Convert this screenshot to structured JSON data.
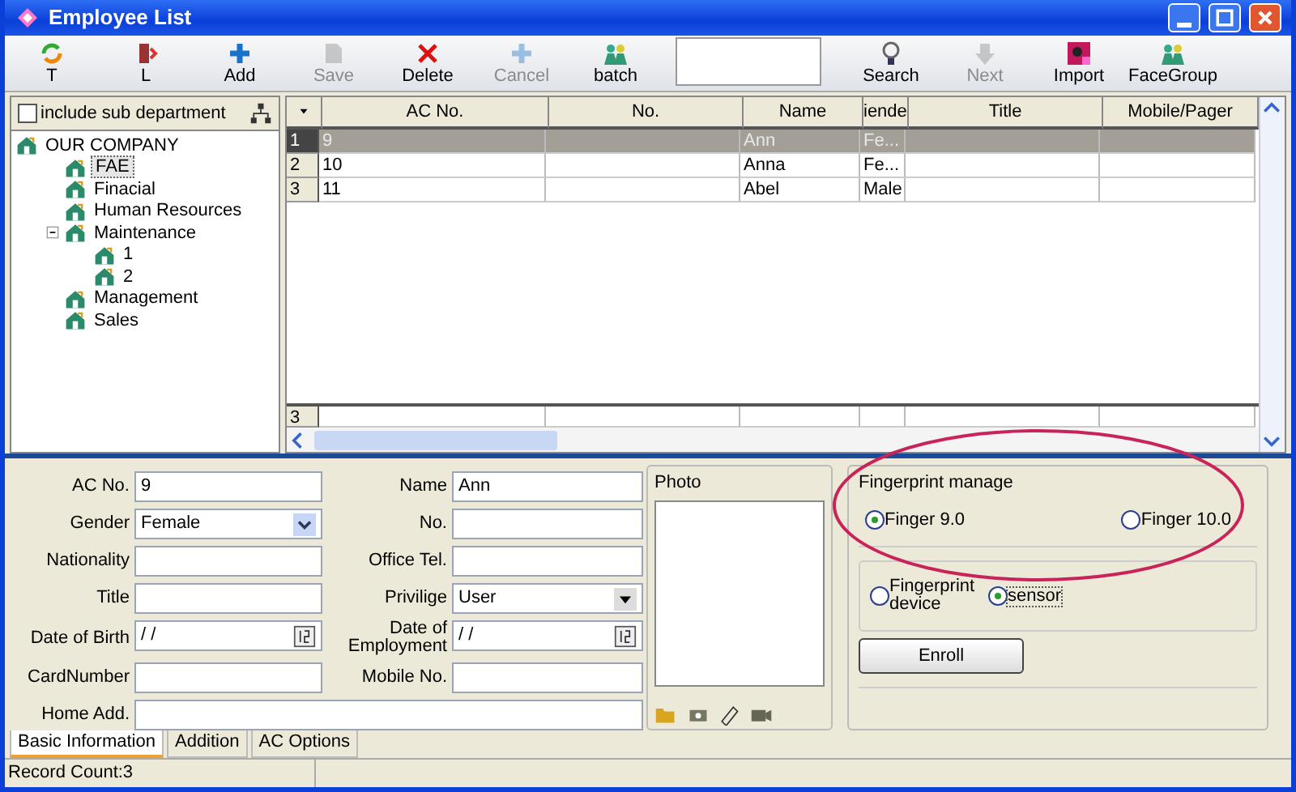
{
  "window": {
    "title": "Employee List"
  },
  "toolbar": [
    {
      "label": "T",
      "disabled": false
    },
    {
      "label": "L",
      "disabled": false
    },
    {
      "label": "Add",
      "disabled": false
    },
    {
      "label": "Save",
      "disabled": true
    },
    {
      "label": "Delete",
      "disabled": false
    },
    {
      "label": "Cancel",
      "disabled": true
    },
    {
      "label": "batch",
      "disabled": false
    },
    {
      "label": "Search",
      "disabled": false
    },
    {
      "label": "Next",
      "disabled": true
    },
    {
      "label": "Import",
      "disabled": false
    },
    {
      "label": "FaceGroup",
      "disabled": false
    }
  ],
  "department_panel": {
    "include_sub_department": {
      "label": "include sub department",
      "checked": false
    },
    "tree": [
      {
        "label": "OUR COMPANY",
        "selected": false,
        "children": [
          {
            "label": "FAE",
            "selected": true
          },
          {
            "label": "Finacial",
            "selected": false
          },
          {
            "label": "Human Resources",
            "selected": false
          },
          {
            "label": "Maintenance",
            "selected": false,
            "expanded": true,
            "children": [
              {
                "label": "1",
                "selected": false
              },
              {
                "label": "2",
                "selected": false
              }
            ]
          },
          {
            "label": "Management",
            "selected": false
          },
          {
            "label": "Sales",
            "selected": false
          }
        ]
      }
    ]
  },
  "grid": {
    "columns": [
      "AC No.",
      "No.",
      "Name",
      "iende",
      "Title",
      "Mobile/Pager"
    ],
    "rows": [
      {
        "row_header": "1",
        "selected": true,
        "ac_no": "9",
        "name": "Ann",
        "column_4": "Fe..."
      },
      {
        "row_header": "2",
        "selected": false,
        "ac_no": "10",
        "name": "Anna",
        "column_4": "Fe..."
      },
      {
        "row_header": "3",
        "selected": false,
        "ac_no": "11",
        "name": "Abel",
        "column_4": "Male"
      }
    ],
    "footer_row": "3"
  },
  "form": {
    "left": [
      {
        "label": "AC No.",
        "kind": "text",
        "value": "9"
      },
      {
        "label": "Gender",
        "kind": "combo",
        "value": "Female"
      },
      {
        "label": "Nationality",
        "kind": "text"
      },
      {
        "label": "Title",
        "kind": "text"
      },
      {
        "label": "Date of Birth",
        "kind": "date",
        "value": "/ /"
      },
      {
        "label": "CardNumber",
        "kind": "text"
      }
    ],
    "right": [
      {
        "label": "Name",
        "kind": "text",
        "value": "Ann"
      },
      {
        "label": "No.",
        "kind": "text"
      },
      {
        "label": "Office Tel.",
        "kind": "text"
      },
      {
        "label": "Privilige",
        "kind": "dropdown",
        "value": "User"
      },
      {
        "label": "Date of Employment",
        "kind": "date",
        "value": "/ /"
      },
      {
        "label": "Mobile No.",
        "kind": "text"
      }
    ],
    "home_address": {
      "label": "Home Add."
    }
  },
  "photo": {
    "title": "Photo"
  },
  "fingerprint": {
    "title": "Fingerprint manage",
    "versions": [
      {
        "label": "Finger 9.0",
        "selected": true
      },
      {
        "label": "Finger 10.0",
        "selected": false
      }
    ],
    "sources": [
      {
        "label": "Fingerprint device",
        "selected": false
      },
      {
        "label": "sensor",
        "selected": true
      }
    ],
    "enroll_button": "Enroll"
  },
  "tabs": [
    {
      "label": "Basic Information",
      "selected": true
    },
    {
      "label": "Addition",
      "selected": false
    },
    {
      "label": "AC Options",
      "selected": false
    }
  ],
  "status_bar": {
    "record_count": "Record Count:3"
  },
  "annotation": {
    "kind": "ellipse"
  }
}
